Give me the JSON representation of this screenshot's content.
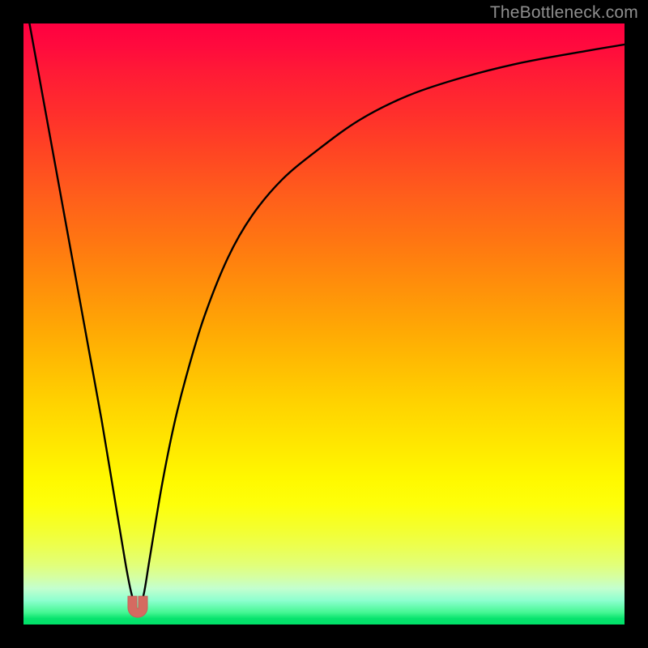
{
  "watermark": "TheBottleneck.com",
  "colors": {
    "page_bg": "#000000",
    "curve_stroke": "#000000",
    "marker_fill": "#d56a61",
    "marker_stroke": "#c85e56",
    "gradient_top": "#ff0040",
    "gradient_bottom": "#00e168"
  },
  "chart_data": {
    "type": "line",
    "title": "",
    "xlabel": "",
    "ylabel": "",
    "x_range": [
      0,
      100
    ],
    "y_range": [
      0,
      100
    ],
    "optimum_x": 19,
    "series": [
      {
        "name": "bottleneck-curve",
        "x": [
          1,
          3,
          5,
          7,
          9,
          11,
          13,
          15,
          17,
          18,
          19,
          20,
          21,
          23,
          25,
          27,
          30,
          34,
          38,
          43,
          49,
          56,
          64,
          73,
          83,
          94,
          100
        ],
        "y": [
          100,
          89,
          78,
          67,
          56,
          45,
          34,
          22,
          10,
          5,
          2,
          5,
          11,
          23,
          33,
          41,
          51,
          61,
          68,
          74,
          79,
          84,
          88,
          91,
          93.5,
          95.5,
          96.5
        ]
      }
    ],
    "marker": {
      "x": 19,
      "y": 2,
      "shape": "u",
      "color": "#d56a61"
    }
  }
}
